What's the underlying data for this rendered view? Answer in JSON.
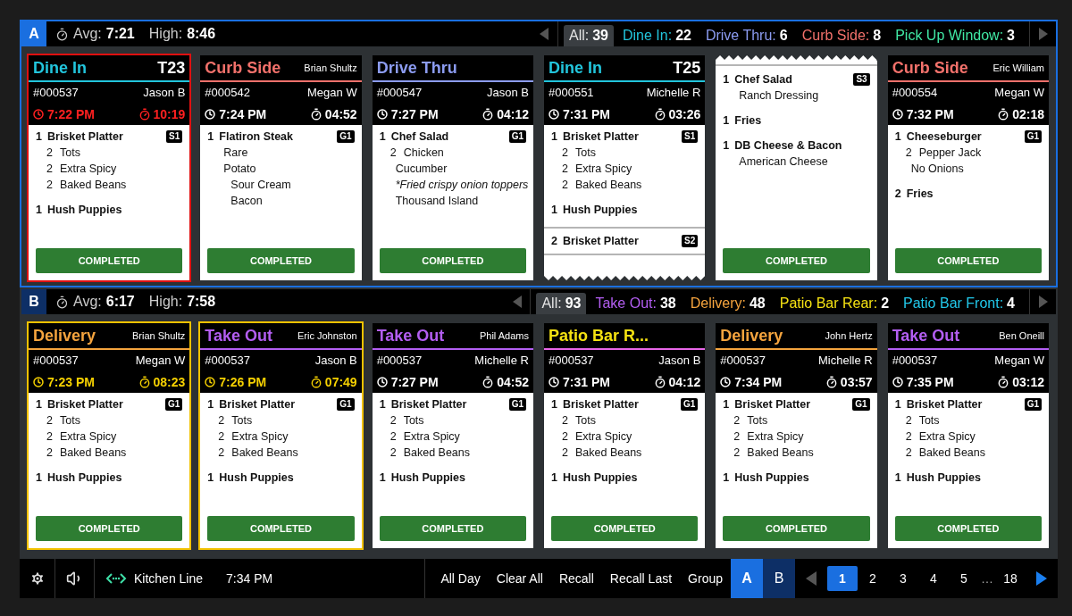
{
  "panels": [
    {
      "letter": "A",
      "selected": true,
      "avg_label": "Avg:",
      "avg": "7:21",
      "high_label": "High:",
      "high": "8:46",
      "filters": [
        {
          "label": "All:",
          "count": "39",
          "color": "#e5e5e5",
          "selected": true
        },
        {
          "label": "Dine In:",
          "count": "22",
          "color": "#22c5dc",
          "selected": false
        },
        {
          "label": "Drive Thru:",
          "count": "6",
          "color": "#8c9cf2",
          "selected": false
        },
        {
          "label": "Curb Side:",
          "count": "8",
          "color": "#f2716b",
          "selected": false
        },
        {
          "label": "Pick Up Window:",
          "count": "3",
          "color": "#40e8a4",
          "selected": false
        }
      ],
      "cards": [
        {
          "kind": "full",
          "title": "Dine In",
          "color": "#22c5dc",
          "underline": {
            "color": "#22c5dc"
          },
          "table": "T23",
          "order": "#000537",
          "server": "Jason B",
          "time": "7:22 PM",
          "elapsed": "10:19",
          "late": true,
          "warning": false,
          "torn_bottom": false,
          "items": [
            {
              "qty": "1",
              "name": "Brisket Platter",
              "tag": "S1",
              "divider_before": false,
              "modifiers": [
                {
                  "qty": "2",
                  "text": "Tots"
                },
                {
                  "qty": "2",
                  "text": "Extra Spicy"
                },
                {
                  "qty": "2",
                  "text": "Baked Beans"
                }
              ]
            },
            {
              "qty": "1",
              "name": "Hush Puppies",
              "divider_before": false
            }
          ],
          "button": "COMPLETED"
        },
        {
          "kind": "full",
          "title": "Curb Side",
          "color": "#f2716b",
          "underline": {
            "color": "#f2716b"
          },
          "customer": "Brian Shultz",
          "order": "#000542",
          "server": "Megan W",
          "time": "7:24 PM",
          "elapsed": "04:52",
          "late": false,
          "warning": false,
          "torn_bottom": false,
          "items": [
            {
              "qty": "1",
              "name": "Flatiron Steak",
              "tag": "G1",
              "divider_before": false,
              "modifiers": [
                {
                  "text": "Rare"
                },
                {
                  "text": "Potato",
                  "children": [
                    {
                      "text": "Sour Cream"
                    },
                    {
                      "text": "Bacon"
                    }
                  ]
                }
              ]
            }
          ],
          "button": "COMPLETED"
        },
        {
          "kind": "full",
          "title": "Drive Thru",
          "color": "#8c9cf2",
          "underline": {
            "color": "#8c9cf2"
          },
          "order": "#000547",
          "server": "Jason B",
          "time": "7:27 PM",
          "elapsed": "04:12",
          "late": false,
          "warning": false,
          "torn_bottom": false,
          "items": [
            {
              "qty": "1",
              "name": "Chef Salad",
              "tag": "G1",
              "divider_before": false,
              "modifiers": [
                {
                  "qty": "2",
                  "text": "Chicken",
                  "italic": false
                },
                {
                  "text": "Cucumber",
                  "italic": false
                },
                {
                  "text": "*Fried crispy onion toppers",
                  "italic": true
                },
                {
                  "text": "Thousand Island",
                  "italic": false
                }
              ]
            }
          ],
          "button": "COMPLETED"
        },
        {
          "kind": "full",
          "title": "Dine In",
          "color": "#22c5dc",
          "underline": {
            "color": "#22c5dc"
          },
          "table": "T25",
          "order": "#000551",
          "server": "Michelle R",
          "time": "7:31 PM",
          "elapsed": "03:26",
          "late": false,
          "warning": false,
          "torn_bottom": true,
          "items": [
            {
              "qty": "1",
              "name": "Brisket Platter",
              "tag": "S1",
              "divider_before": false,
              "modifiers": [
                {
                  "qty": "2",
                  "text": "Tots"
                },
                {
                  "qty": "2",
                  "text": "Extra Spicy"
                },
                {
                  "qty": "2",
                  "text": "Baked Beans"
                }
              ]
            },
            {
              "qty": "1",
              "name": "Hush Puppies",
              "divider_before": false
            },
            {
              "qty": "2",
              "name": "Brisket Platter",
              "tag": "S2",
              "divider_before": true
            }
          ]
        },
        {
          "kind": "continued",
          "late": false,
          "warning": false,
          "torn_bottom": false,
          "items": [
            {
              "qty": "1",
              "name": "Chef Salad",
              "tag": "S3",
              "divider_before": false,
              "modifiers": [
                {
                  "text": "Ranch Dressing"
                }
              ]
            },
            {
              "qty": "1",
              "name": "Fries",
              "divider_before": false
            },
            {
              "qty": "1",
              "name": "DB Cheese & Bacon",
              "divider_before": false,
              "modifiers": [
                {
                  "text": "American Cheese"
                }
              ]
            }
          ],
          "button": "COMPLETED"
        },
        {
          "kind": "full",
          "title": "Curb Side",
          "color": "#f2716b",
          "underline": {
            "color": "#f2716b"
          },
          "customer": "Eric William",
          "order": "#000554",
          "server": "Megan W",
          "time": "7:32 PM",
          "elapsed": "02:18",
          "late": false,
          "warning": false,
          "torn_bottom": false,
          "items": [
            {
              "qty": "1",
              "name": "Cheeseburger",
              "tag": "G1",
              "divider_before": false,
              "modifiers": [
                {
                  "qty": "2",
                  "text": "Pepper Jack"
                },
                {
                  "text": "No Onions"
                }
              ]
            },
            {
              "qty": "2",
              "name": "Fries",
              "divider_before": false
            }
          ],
          "button": "COMPLETED"
        }
      ]
    },
    {
      "letter": "B",
      "selected": false,
      "avg_label": "Avg:",
      "avg": "6:17",
      "high_label": "High:",
      "high": "7:58",
      "filters": [
        {
          "label": "All:",
          "count": "93",
          "color": "#e5e5e5",
          "selected": true
        },
        {
          "label": "Take Out:",
          "count": "38",
          "color": "#b35ef2",
          "selected": false
        },
        {
          "label": "Delivery:",
          "count": "48",
          "color": "#f5a43e",
          "selected": false
        },
        {
          "label": "Patio Bar Rear:",
          "count": "2",
          "color": "#f5e212",
          "selected": false
        },
        {
          "label": "Patio Bar Front:",
          "count": "4",
          "color": "#22c8ea",
          "selected": false
        }
      ],
      "cards": [
        {
          "kind": "full",
          "title": "Delivery",
          "color": "#f5a43e",
          "underline": {
            "color": "#f5a43e"
          },
          "customer": "Brian Shultz",
          "order": "#000537",
          "server": "Megan W",
          "time": "7:23 PM",
          "elapsed": "08:23",
          "late": false,
          "warning": true,
          "torn_bottom": false,
          "items": [
            {
              "qty": "1",
              "name": "Brisket Platter",
              "tag": "G1",
              "divider_before": false,
              "modifiers": [
                {
                  "qty": "2",
                  "text": "Tots"
                },
                {
                  "qty": "2",
                  "text": "Extra Spicy"
                },
                {
                  "qty": "2",
                  "text": "Baked Beans"
                }
              ]
            },
            {
              "qty": "1",
              "name": "Hush Puppies",
              "divider_before": false
            }
          ],
          "button": "COMPLETED"
        },
        {
          "kind": "full",
          "title": "Take Out",
          "color": "#b35ef2",
          "underline": {
            "color": "#b35ef2"
          },
          "customer": "Eric Johnston",
          "order": "#000537",
          "server": "Jason B",
          "time": "7:26 PM",
          "elapsed": "07:49",
          "late": false,
          "warning": true,
          "torn_bottom": false,
          "items": [
            {
              "qty": "1",
              "name": "Brisket Platter",
              "tag": "G1",
              "divider_before": false,
              "modifiers": [
                {
                  "qty": "2",
                  "text": "Tots"
                },
                {
                  "qty": "2",
                  "text": "Extra Spicy"
                },
                {
                  "qty": "2",
                  "text": "Baked Beans"
                }
              ]
            },
            {
              "qty": "1",
              "name": "Hush Puppies",
              "divider_before": false
            }
          ],
          "button": "COMPLETED"
        },
        {
          "kind": "full",
          "title": "Take Out",
          "color": "#b35ef2",
          "underline": {
            "color": "#b35ef2"
          },
          "customer": "Phil Adams",
          "order": "#000537",
          "server": "Michelle R",
          "time": "7:27 PM",
          "elapsed": "04:52",
          "late": false,
          "warning": false,
          "torn_bottom": false,
          "items": [
            {
              "qty": "1",
              "name": "Brisket Platter",
              "tag": "G1",
              "divider_before": false,
              "modifiers": [
                {
                  "qty": "2",
                  "text": "Tots"
                },
                {
                  "qty": "2",
                  "text": "Extra Spicy"
                },
                {
                  "qty": "2",
                  "text": "Baked Beans"
                }
              ]
            },
            {
              "qty": "1",
              "name": "Hush Puppies",
              "divider_before": false
            }
          ],
          "button": "COMPLETED"
        },
        {
          "kind": "full",
          "title": "Patio Bar R...",
          "color": "#f5e212",
          "underline": {
            "color": "#e866e8"
          },
          "order": "#000537",
          "server": "Jason B",
          "time": "7:31 PM",
          "elapsed": "04:12",
          "late": false,
          "warning": false,
          "torn_bottom": false,
          "items": [
            {
              "qty": "1",
              "name": "Brisket Platter",
              "tag": "G1",
              "divider_before": false,
              "modifiers": [
                {
                  "qty": "2",
                  "text": "Tots"
                },
                {
                  "qty": "2",
                  "text": "Extra Spicy"
                },
                {
                  "qty": "2",
                  "text": "Baked Beans"
                }
              ]
            },
            {
              "qty": "1",
              "name": "Hush Puppies",
              "divider_before": false
            }
          ],
          "button": "COMPLETED"
        },
        {
          "kind": "full",
          "title": "Delivery",
          "color": "#f5a43e",
          "underline": {
            "color": "#f5a43e"
          },
          "customer": "John Hertz",
          "order": "#000537",
          "server": "Michelle R",
          "time": "7:34 PM",
          "elapsed": "03:57",
          "late": false,
          "warning": false,
          "torn_bottom": false,
          "items": [
            {
              "qty": "1",
              "name": "Brisket Platter",
              "tag": "G1",
              "divider_before": false,
              "modifiers": [
                {
                  "qty": "2",
                  "text": "Tots"
                },
                {
                  "qty": "2",
                  "text": "Extra Spicy"
                },
                {
                  "qty": "2",
                  "text": "Baked Beans"
                }
              ]
            },
            {
              "qty": "1",
              "name": "Hush Puppies",
              "divider_before": false
            }
          ],
          "button": "COMPLETED"
        },
        {
          "kind": "full",
          "title": "Take Out",
          "color": "#b35ef2",
          "underline": {
            "color": "#b35ef2"
          },
          "customer": "Ben Oneill",
          "order": "#000537",
          "server": "Megan W",
          "time": "7:35 PM",
          "elapsed": "03:12",
          "late": false,
          "warning": false,
          "torn_bottom": false,
          "items": [
            {
              "qty": "1",
              "name": "Brisket Platter",
              "tag": "G1",
              "divider_before": false,
              "modifiers": [
                {
                  "qty": "2",
                  "text": "Tots"
                },
                {
                  "qty": "2",
                  "text": "Extra Spicy"
                },
                {
                  "qty": "2",
                  "text": "Baked Beans"
                }
              ]
            },
            {
              "qty": "1",
              "name": "Hush Puppies",
              "divider_before": false
            }
          ],
          "button": "COMPLETED"
        }
      ]
    }
  ],
  "footer": {
    "station": "Kitchen Line",
    "clock": "7:34 PM",
    "actions": [
      "All Day",
      "Clear All",
      "Recall",
      "Recall Last",
      "Group"
    ],
    "screens": [
      {
        "label": "A",
        "selected": true
      },
      {
        "label": "B",
        "selected": false
      }
    ],
    "pages": [
      {
        "label": "1",
        "selected": true
      },
      {
        "label": "2",
        "selected": false
      },
      {
        "label": "3",
        "selected": false
      },
      {
        "label": "4",
        "selected": false
      },
      {
        "label": "5",
        "selected": false
      }
    ],
    "ellipsis": "…",
    "last_page": {
      "label": "18",
      "selected": false
    },
    "prev_disabled": true,
    "next_disabled": false
  }
}
